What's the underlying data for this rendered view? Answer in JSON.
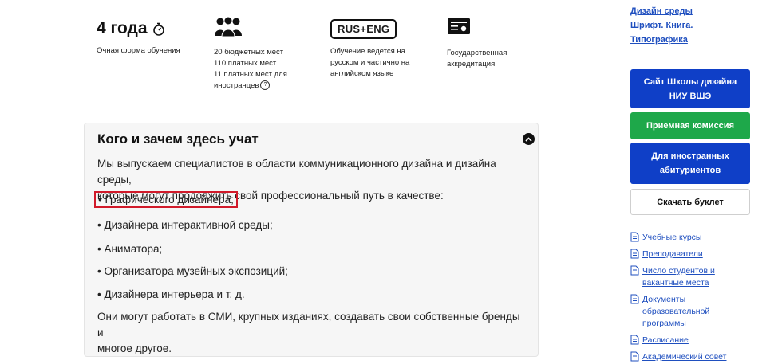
{
  "facts": {
    "duration_value": "4 года",
    "duration_caption": "Очная форма обучения",
    "places": [
      "20 бюджетных мест",
      "110 платных мест",
      "11 платных мест для",
      "иностранцев"
    ],
    "language_badge": "RUS+ENG",
    "language_caption": [
      "Обучение ведется на",
      "русском и частично на",
      "английском языке"
    ],
    "accreditation_caption": [
      "Государственная",
      "аккредитация"
    ],
    "help_symbol": "?"
  },
  "accordion": {
    "title": "Кого и зачем здесь учат",
    "intro": [
      "Мы выпускаем специалистов в области коммуникационного дизайна и дизайна среды,",
      "которые могут продолжить свой профессиональный путь в качестве:"
    ],
    "items": [
      "• Графического дизайнера;",
      "• Дизайнера интерактивной среды;",
      "• Аниматора;",
      "• Организатора музейных экспозиций;",
      "• Дизайнера интерьера и т. д."
    ],
    "outro": [
      "Они могут работать в СМИ, крупных изданиях, создавать свои собственные бренды и",
      "многое другое."
    ]
  },
  "sidebar": {
    "top_links": [
      "Дизайн среды",
      "Шрифт. Книга.",
      "Типографика"
    ],
    "buttons": {
      "school_site": [
        "Сайт Школы дизайна",
        "НИУ ВШЭ"
      ],
      "admissions": "Приемная комиссия",
      "foreign": [
        "Для иностранных",
        "абитуриентов"
      ],
      "booklet": "Скачать буклет"
    },
    "doc_links": [
      [
        "Учебные курсы"
      ],
      [
        "Преподаватели"
      ],
      [
        "Число студентов и",
        "вакантные места"
      ],
      [
        "Документы",
        "образовательной",
        "программы"
      ],
      [
        "Расписание"
      ],
      [
        "Академический совет"
      ]
    ],
    "colors": {
      "link": "#1f4fbf",
      "button_blue": "#0f3fc7",
      "button_green": "#1ea84a",
      "highlight": "#d11a2a"
    }
  }
}
